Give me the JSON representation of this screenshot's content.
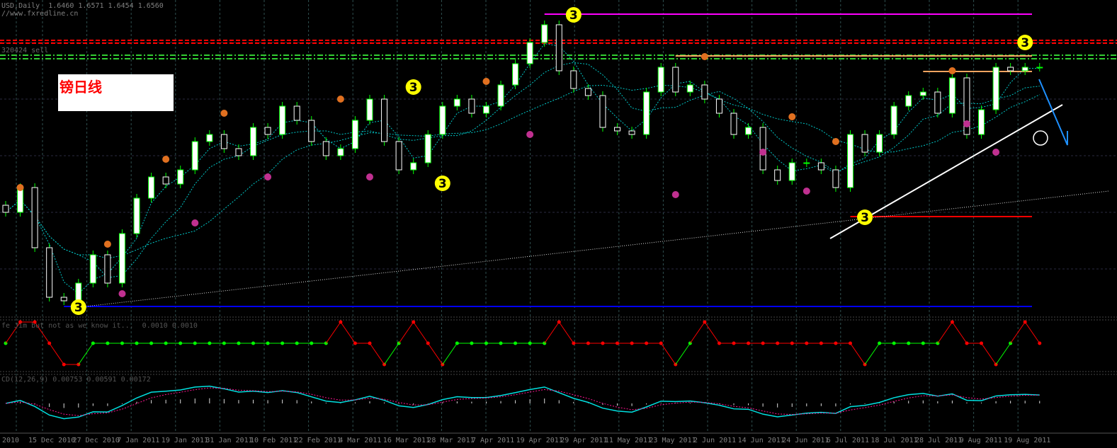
{
  "header": {
    "symbol_line": "USD,Daily",
    "ohlc": [
      "1.6460",
      "1.6571",
      "1.6454",
      "1.6560"
    ],
    "source": "//www.fxredline.cn",
    "level_note": "320424 sell"
  },
  "chart_label": "镑日线",
  "indicator1_label": "fe Jim but not as we know it...  0.0010 0.0010",
  "indicator2_label": "CD(12,26,9) 0.00753 0.00591 0.00172",
  "colors": {
    "bull": "#ffffff",
    "bear": "#000000",
    "wick": "#00ff00",
    "ma": "#00c8c8",
    "grid": "#2f4f4f"
  },
  "chart_data": {
    "type": "candlestick",
    "title": "USD,Daily",
    "closes": [
      1.615,
      1.622,
      1.605,
      1.591,
      1.59,
      1.595,
      1.603,
      1.595,
      1.609,
      1.619,
      1.625,
      1.623,
      1.627,
      1.635,
      1.637,
      1.633,
      1.631,
      1.639,
      1.637,
      1.645,
      1.641,
      1.635,
      1.631,
      1.633,
      1.641,
      1.647,
      1.635,
      1.627,
      1.629,
      1.637,
      1.645,
      1.647,
      1.643,
      1.645,
      1.651,
      1.657,
      1.663,
      1.668,
      1.655,
      1.65,
      1.648,
      1.639,
      1.638,
      1.637,
      1.649,
      1.656,
      1.649,
      1.651,
      1.647,
      1.643,
      1.637,
      1.639,
      1.627,
      1.624,
      1.629,
      1.629,
      1.627,
      1.622,
      1.637,
      1.632,
      1.637,
      1.645,
      1.648,
      1.649,
      1.643,
      1.653,
      1.637,
      1.644,
      1.656,
      1.655,
      1.656,
      1.656
    ],
    "price_range": [
      1.586,
      1.675
    ],
    "levels": [
      {
        "name": "magenta-resistance",
        "price": 1.671,
        "color": "#ff00ff",
        "from": 37,
        "style": "solid"
      },
      {
        "name": "red-dashed-1",
        "price": 1.6636,
        "color": "#ff0000",
        "from": 0,
        "style": "dash"
      },
      {
        "name": "red-dashed-2",
        "price": 1.6628,
        "color": "#ff0000",
        "from": 0,
        "style": "dash"
      },
      {
        "name": "green-dashdot-1",
        "price": 1.6594,
        "color": "#32cd32",
        "from": 0,
        "style": "dashdot"
      },
      {
        "name": "green-dashdot-2",
        "price": 1.6584,
        "color": "#32cd32",
        "from": 0,
        "style": "dashdot"
      },
      {
        "name": "orange-level-1",
        "price": 1.6592,
        "color": "#f4a460",
        "from": 46,
        "style": "solid"
      },
      {
        "name": "orange-level-2",
        "price": 1.6548,
        "color": "#f4a460",
        "from": 63,
        "style": "solid"
      },
      {
        "name": "red-support",
        "price": 1.6138,
        "color": "#ff0000",
        "from": 58,
        "style": "solid"
      },
      {
        "name": "blue-support",
        "price": 1.5884,
        "color": "#0000ff",
        "from": 4,
        "style": "solid"
      }
    ],
    "wave_markers": [
      {
        "index": 5,
        "price": 1.5882,
        "label": "3"
      },
      {
        "index": 28,
        "price": 1.6504,
        "label": "3"
      },
      {
        "index": 30,
        "price": 1.6232,
        "label": "3"
      },
      {
        "index": 39,
        "price": 1.6708,
        "label": "3"
      },
      {
        "index": 59,
        "price": 1.6136,
        "label": "3"
      },
      {
        "index": 70,
        "price": 1.663,
        "label": "3"
      }
    ],
    "fractals": [
      {
        "index": 1,
        "price": 1.622,
        "type": "up"
      },
      {
        "index": 7,
        "price": 1.606,
        "type": "up"
      },
      {
        "index": 8,
        "price": 1.592,
        "type": "down"
      },
      {
        "index": 11,
        "price": 1.63,
        "type": "up"
      },
      {
        "index": 13,
        "price": 1.612,
        "type": "down"
      },
      {
        "index": 15,
        "price": 1.643,
        "type": "up"
      },
      {
        "index": 18,
        "price": 1.625,
        "type": "down"
      },
      {
        "index": 23,
        "price": 1.647,
        "type": "up"
      },
      {
        "index": 25,
        "price": 1.625,
        "type": "down"
      },
      {
        "index": 33,
        "price": 1.652,
        "type": "up"
      },
      {
        "index": 36,
        "price": 1.637,
        "type": "down"
      },
      {
        "index": 46,
        "price": 1.62,
        "type": "down"
      },
      {
        "index": 48,
        "price": 1.659,
        "type": "up"
      },
      {
        "index": 52,
        "price": 1.632,
        "type": "down"
      },
      {
        "index": 54,
        "price": 1.642,
        "type": "up"
      },
      {
        "index": 55,
        "price": 1.621,
        "type": "down"
      },
      {
        "index": 57,
        "price": 1.635,
        "type": "up"
      },
      {
        "index": 65,
        "price": 1.655,
        "type": "up"
      },
      {
        "index": 66,
        "price": 1.64,
        "type": "down"
      },
      {
        "index": 68,
        "price": 1.632,
        "type": "down"
      }
    ],
    "oscillator": [
      0,
      1,
      1,
      0,
      -1,
      -1,
      0,
      0,
      0,
      0,
      0,
      0,
      0,
      0,
      0,
      0,
      0,
      0,
      0,
      0,
      0,
      0,
      0,
      1,
      0,
      0,
      -1,
      0,
      1,
      0,
      -1,
      0,
      0,
      0,
      0,
      0,
      0,
      0,
      1,
      0,
      0,
      0,
      0,
      0,
      0,
      0,
      -1,
      0,
      1,
      0,
      0,
      0,
      0,
      0,
      0,
      0,
      0,
      0,
      0,
      -1,
      0,
      0,
      0,
      0,
      0,
      1,
      0,
      0,
      -1,
      0,
      1,
      0
    ],
    "x_labels": [
      "2010",
      "15 Dec 2010",
      "27 Dec 2010",
      "7 Jan 2011",
      "19 Jan 2011",
      "31 Jan 2011",
      "10 Feb 2011",
      "22 Feb 2011",
      "4 Mar 2011",
      "16 Mar 2011",
      "28 Mar 2011",
      "7 Apr 2011",
      "19 Apr 2011",
      "29 Apr 2011",
      "11 May 2011",
      "23 May 2011",
      "2 Jun 2011",
      "14 Jun 2011",
      "24 Jun 2011",
      "6 Jul 2011",
      "18 Jul 2011",
      "28 Jul 2011",
      "9 Aug 2011",
      "19 Aug 2011"
    ]
  }
}
